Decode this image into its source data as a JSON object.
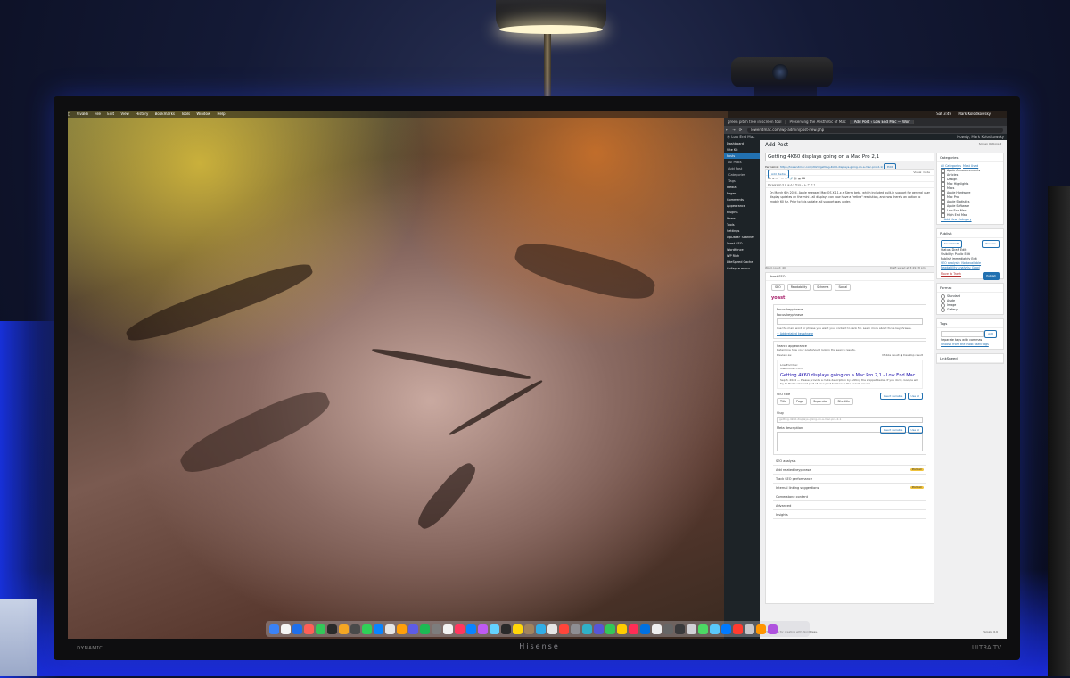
{
  "scene": {
    "monitor_brand": "Hisense",
    "monitor_left_text": "ᴅʏɴᴀᴍɪᴄ",
    "monitor_right_text": "ULTRA TV"
  },
  "menubar": {
    "apple": "",
    "app_name": "Vivaldi",
    "items": [
      "File",
      "Edit",
      "View",
      "History",
      "Bookmarks",
      "Tools",
      "Window",
      "Help"
    ],
    "clock": "Sat 3:49",
    "user": "Mark Kolodkowsky"
  },
  "browser": {
    "tabs": [
      {
        "label": "green pitch tree in screen tool",
        "active": false
      },
      {
        "label": "Preserving the Aesthetic of Mac",
        "active": false
      },
      {
        "label": "Add Post ‹ Low End Mac — Wor",
        "active": true
      }
    ],
    "url": "lowendmac.com/wp-admin/post-new.php"
  },
  "adminbar": {
    "site": "Low End Mac",
    "user": "Howdy, Mark Kolodkowsky"
  },
  "sidebar": {
    "items": [
      {
        "label": "Dashboard",
        "current": false,
        "sub": false
      },
      {
        "label": "Site Kit",
        "current": false,
        "sub": false
      },
      {
        "label": "Posts",
        "current": true,
        "sub": false
      },
      {
        "label": "All Posts",
        "current": false,
        "sub": true
      },
      {
        "label": "Add Post",
        "current": false,
        "sub": true
      },
      {
        "label": "Categories",
        "current": false,
        "sub": true
      },
      {
        "label": "Tags",
        "current": false,
        "sub": true
      },
      {
        "label": "Media",
        "current": false,
        "sub": false
      },
      {
        "label": "Pages",
        "current": false,
        "sub": false
      },
      {
        "label": "Comments",
        "current": false,
        "sub": false
      },
      {
        "label": "Appearance",
        "current": false,
        "sub": false
      },
      {
        "label": "Plugins",
        "current": false,
        "sub": false
      },
      {
        "label": "Users",
        "current": false,
        "sub": false
      },
      {
        "label": "Tools",
        "current": false,
        "sub": false
      },
      {
        "label": "Settings",
        "current": false,
        "sub": false
      },
      {
        "label": "wpDataF Scanner",
        "current": false,
        "sub": false
      },
      {
        "label": "Yoast SEO",
        "current": false,
        "sub": false
      },
      {
        "label": "Wordfence",
        "current": false,
        "sub": false
      },
      {
        "label": "WP Rich",
        "current": false,
        "sub": false
      },
      {
        "label": "LiteSpeed Cache",
        "current": false,
        "sub": false
      },
      {
        "label": "Collapse menu",
        "current": false,
        "sub": false
      }
    ]
  },
  "editor": {
    "page_title": "Add Post",
    "screen_options": "Screen Options ▾",
    "post_title": "Getting 4K60 displays going on a Mac Pro 2,1",
    "permalink_label": "Permalink:",
    "permalink_url": "https://lowendmac.com/2024/getting-4k60-displays-going-on-a-mac-pro-2-1/",
    "edit_btn": "Edit",
    "add_media": "Add Media",
    "tab_visual": "Visual",
    "tab_code": "Code",
    "paragraph": "Paragraph",
    "content": "On March 6th 2024, Apple released Mac OS X 11.x a Sierra beta, which included built-in support for general user display updates on the mini - all displays can now have a \"retina\" resolution, and now there's an option to enable 60 Hz. Prior to this update, all support was under.",
    "word_count": "Word count: 40",
    "saved": "Draft saved at 3:49:18 pm."
  },
  "yoast": {
    "header": "Yoast SEO",
    "tabs": [
      "SEO",
      "Readability",
      "Schema",
      "Social"
    ],
    "logo": "yoast",
    "focus_label": "Focus keyphrase",
    "focus_sub": "Focus keyphrase",
    "focus_help": "Use the main word or phrase you want your content to rank for. Learn more about focus keyphrases.",
    "related": "+ Add related keyphrase",
    "search_appearance": "Search appearance",
    "search_help": "Determine how your post should look in the search results.",
    "preview_as": "Preview as:",
    "mobile": "Mobile result",
    "desktop": "Desktop result",
    "site_name": "Low End Mac",
    "site_url": "lowendmac.com",
    "serp_title": "Getting 4K60 displays going on a Mac Pro 2,1 - Low End Mac",
    "serp_desc": "Sep 3, 2024 — Please provide a meta description by editing the snippet below. If you don't, Google will try to find a relevant part of your post to show in the search results.",
    "seo_title_label": "SEO title",
    "insert_var": "Insert variable",
    "use_ai": "Use AI",
    "title_vars": [
      "Title",
      "Page",
      "Separator",
      "Site title"
    ],
    "slug_label": "Slug",
    "slug_value": "getting-4k60-displays-going-on-a-mac-pro-2-1",
    "meta_label": "Meta description",
    "rows": [
      {
        "label": "SEO analysis",
        "badge": ""
      },
      {
        "label": "Add related keyphrase",
        "badge": "Premium"
      },
      {
        "label": "Track SEO performance",
        "badge": ""
      },
      {
        "label": "Internal linking suggestions",
        "badge": "Premium"
      },
      {
        "label": "Cornerstone content",
        "badge": ""
      },
      {
        "label": "Advanced",
        "badge": ""
      },
      {
        "label": "Insights",
        "badge": ""
      }
    ],
    "footer": "Thank you for creating with WordPress.",
    "version": "Version 6.6"
  },
  "rightcol": {
    "categories_title": "Categories",
    "cat_tabs": [
      "All Categories",
      "Most Used"
    ],
    "categories": [
      "Apple Announcements",
      "Articles",
      "Design",
      "Mac Highlights",
      "Macs",
      "Apple Hardware",
      "Mac Pro",
      "Apple Statistics",
      "Apple Software",
      "Low End Mac",
      "High End Mac"
    ],
    "add_category": "+ Add New Category",
    "publish_title": "Publish",
    "save_draft": "Save Draft",
    "preview": "Preview",
    "status": "Status: Draft Edit",
    "visibility": "Visibility: Public Edit",
    "publish_when": "Publish immediately Edit",
    "seo_status": "SEO analysis: Not available",
    "readability": "Readability analysis: Good",
    "trash": "Move to Trash",
    "publish_btn": "Publish",
    "format_title": "Format",
    "formats": [
      "Standard",
      "Aside",
      "Image",
      "Gallery"
    ],
    "tags_title": "Tags",
    "tag_add": "Add",
    "tag_help": "Separate tags with commas",
    "tag_choose": "Choose from the most used tags",
    "linkpatrol": "LinkSpeed"
  },
  "dock": {
    "icon_colors": [
      "#3b82f6",
      "#f4f4f4",
      "#1f6feb",
      "#ff5f57",
      "#34c759",
      "#2a2a2a",
      "#f5a623",
      "#4a4a4a",
      "#30d158",
      "#0a84ff",
      "#e5e5e5",
      "#ff9f0a",
      "#5e5ce6",
      "#1db954",
      "#7d7d7d",
      "#f2f2f2",
      "#ff375f",
      "#0a84ff",
      "#bf5af2",
      "#64d2ff",
      "#2a2a2a",
      "#ffd60a",
      "#a2845e",
      "#32ade6",
      "#e5e5e5",
      "#ff453a",
      "#8e8e93",
      "#30b0c7",
      "#5856d6",
      "#34c759",
      "#ffcc00",
      "#ff2d55",
      "#0071e3",
      "#eeeeee",
      "#666666",
      "#3a3a3c",
      "#d1d1d6",
      "#4cd964",
      "#5ac8fa",
      "#007aff",
      "#ff3b30",
      "#c7c7cc",
      "#ff9500",
      "#af52de"
    ]
  }
}
